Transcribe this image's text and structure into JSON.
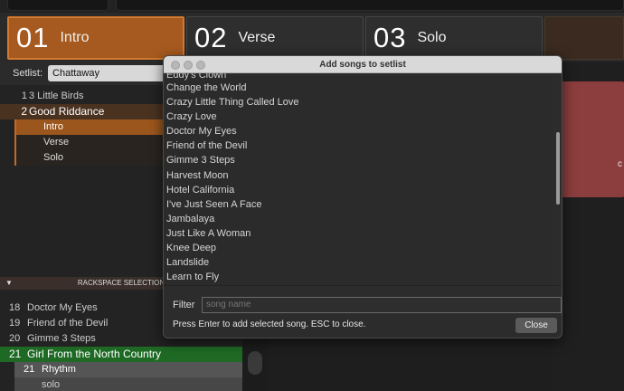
{
  "parts": [
    {
      "num": "01",
      "name": "Intro"
    },
    {
      "num": "02",
      "name": "Verse"
    },
    {
      "num": "03",
      "name": "Solo"
    }
  ],
  "setlist": {
    "label": "Setlist:",
    "value": "Chattaway"
  },
  "songs": [
    {
      "num": "1",
      "name": "3 Little Birds"
    },
    {
      "num": "2",
      "name": "Good Riddance"
    }
  ],
  "song_parts": [
    "Intro",
    "Verse",
    "Solo"
  ],
  "rackspace": {
    "header": "RACKSPACE SELECTION",
    "items": [
      {
        "num": "18",
        "name": "Doctor My Eyes"
      },
      {
        "num": "19",
        "name": "Friend of the Devil"
      },
      {
        "num": "20",
        "name": "Gimme 3 Steps"
      },
      {
        "num": "21",
        "name": "Girl From the North Country"
      }
    ],
    "variation": {
      "num": "21",
      "name": "Rhythm"
    },
    "variation2": {
      "name": "solo"
    }
  },
  "dialog": {
    "title": "Add songs to setlist",
    "clipped_item": "Eddy's Clown",
    "songs": [
      "Change the World",
      "Crazy Little Thing Called Love",
      "Crazy Love",
      "Doctor My Eyes",
      "Friend of the Devil",
      "Gimme 3 Steps",
      "Harvest Moon",
      "Hotel California",
      "I've Just Seen A Face",
      "Jambalaya",
      "Just Like A Woman",
      "Knee Deep",
      "Landslide",
      "Learn to Fly"
    ],
    "filter_label": "Filter",
    "filter_placeholder": "song name",
    "hint": "Press Enter to add selected song. ESC to close.",
    "close_label": "Close"
  },
  "colors": {
    "accent": "#a65a1f",
    "selection_green": "#1e6a24",
    "panel_red": "#8c3d3d"
  }
}
